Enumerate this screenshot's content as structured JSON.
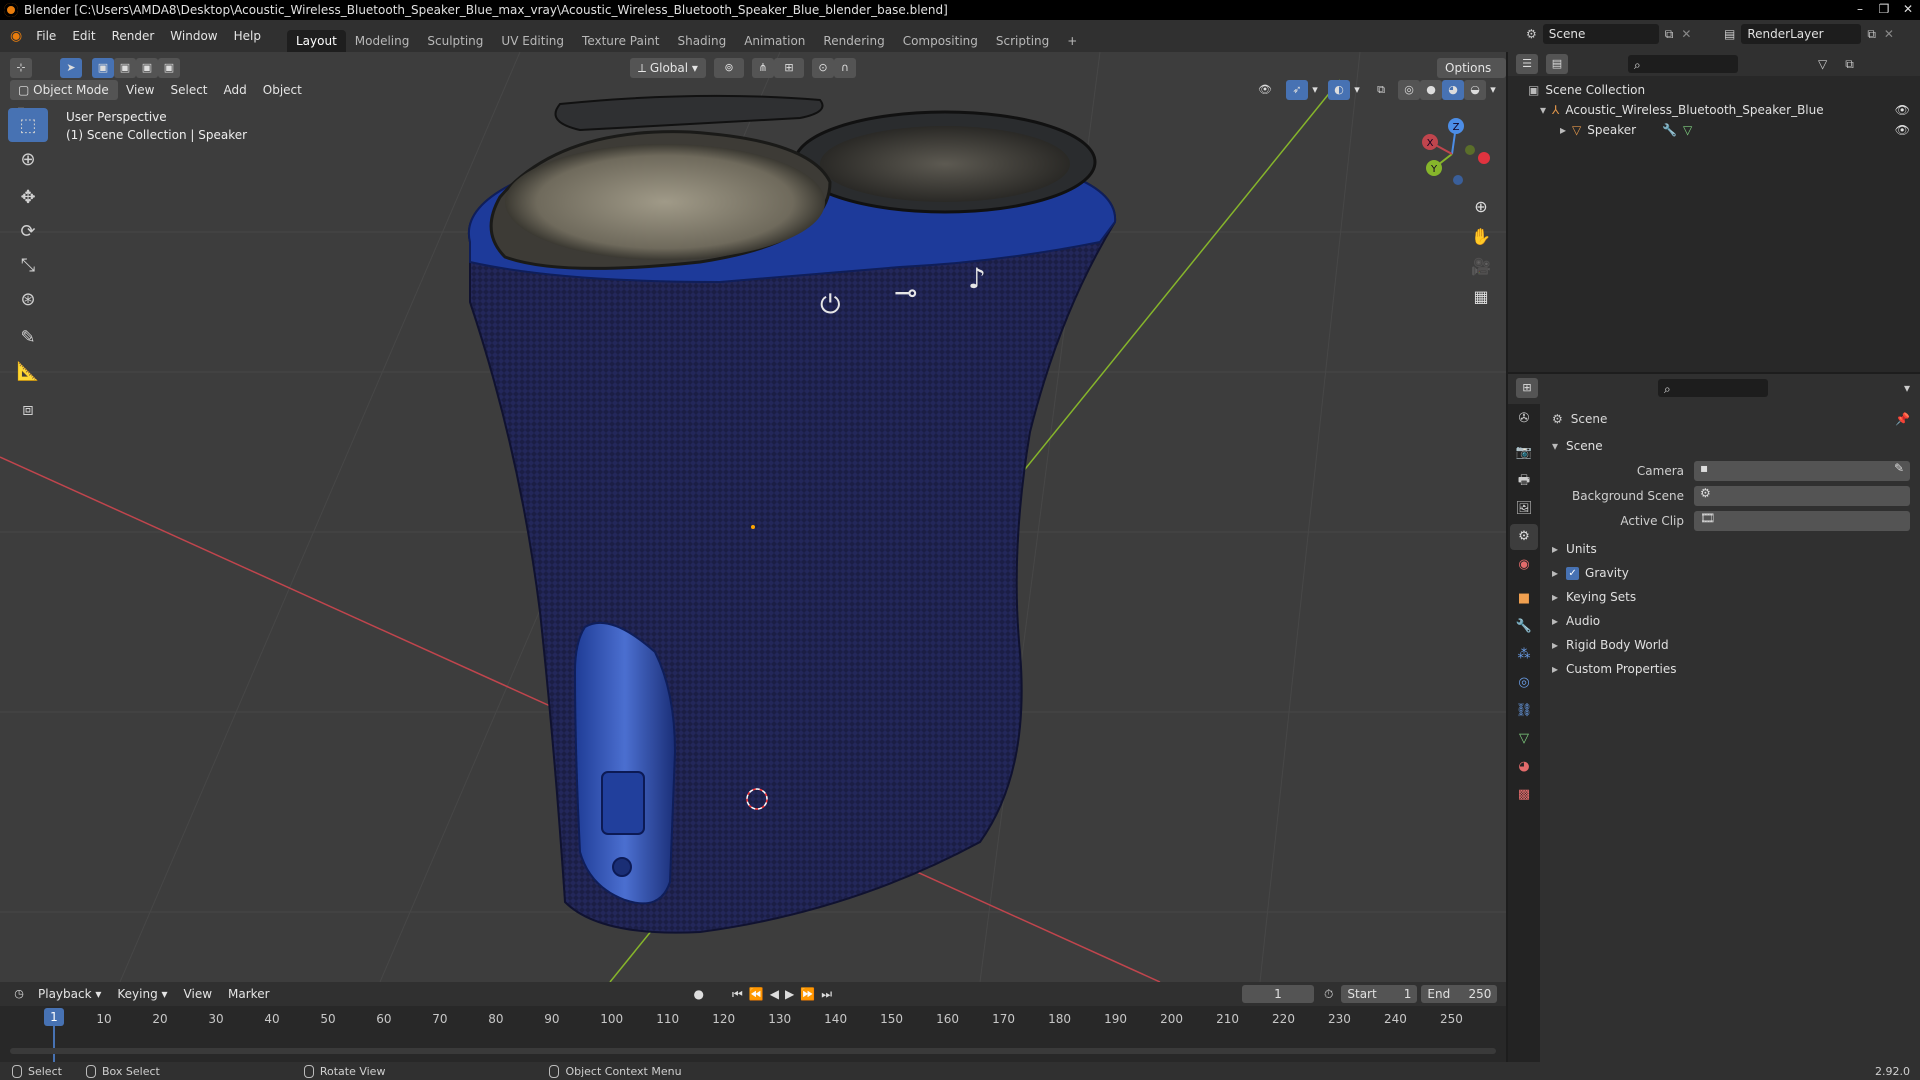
{
  "window": {
    "title": "Blender [C:\\Users\\AMDA8\\Desktop\\Acoustic_Wireless_Bluetooth_Speaker_Blue_max_vray\\Acoustic_Wireless_Bluetooth_Speaker_Blue_blender_base.blend]",
    "controls": [
      "–",
      "❐",
      "✕"
    ]
  },
  "menu": [
    "File",
    "Edit",
    "Render",
    "Window",
    "Help"
  ],
  "workspaces": [
    "Layout",
    "Modeling",
    "Sculpting",
    "UV Editing",
    "Texture Paint",
    "Shading",
    "Animation",
    "Rendering",
    "Compositing",
    "Scripting",
    "+"
  ],
  "scene_selector": {
    "value": "Scene"
  },
  "renderlayer_selector": {
    "value": "RenderLayer"
  },
  "viewport": {
    "mode": "Object Mode",
    "menus": [
      "View",
      "Select",
      "Add",
      "Object"
    ],
    "transform_orientation": "Global",
    "options_label": "Options",
    "info_line1": "User Perspective",
    "info_line2": "(1) Scene Collection | Speaker",
    "gizmo_axes": [
      "X",
      "Y",
      "Z"
    ],
    "speaker_icons": [
      "⏻",
      "⊸",
      "♪"
    ]
  },
  "outliner": {
    "root": "Scene Collection",
    "collection": "Acoustic_Wireless_Bluetooth_Speaker_Blue",
    "object": "Speaker"
  },
  "properties": {
    "context": "Scene",
    "panel_title": "Scene",
    "fields": [
      {
        "label": "Camera"
      },
      {
        "label": "Background Scene"
      },
      {
        "label": "Active Clip"
      }
    ],
    "panels": [
      "Units",
      "Gravity",
      "Keying Sets",
      "Audio",
      "Rigid Body World",
      "Custom Properties"
    ],
    "gravity_checked": true
  },
  "timeline": {
    "menus": [
      "Playback",
      "Keying",
      "View",
      "Marker"
    ],
    "current_frame": "1",
    "start_label": "Start",
    "start_value": "1",
    "end_label": "End",
    "end_value": "250",
    "ticks": [
      "1",
      "10",
      "20",
      "30",
      "40",
      "50",
      "60",
      "70",
      "80",
      "90",
      "100",
      "110",
      "120",
      "130",
      "140",
      "150",
      "160",
      "170",
      "180",
      "190",
      "200",
      "210",
      "220",
      "230",
      "240",
      "250"
    ]
  },
  "statusbar": {
    "select": "Select",
    "box_select": "Box Select",
    "rotate_view": "Rotate View",
    "context_menu": "Object Context Menu",
    "version": "2.92.0"
  },
  "colors": {
    "accent": "#4772b3",
    "viewport_bg": "#3d3d3d",
    "speaker_fabric": "#1b1e45",
    "speaker_top": "#1d3a9a",
    "axis_x": "#c0454d",
    "axis_y": "#86b52b"
  }
}
